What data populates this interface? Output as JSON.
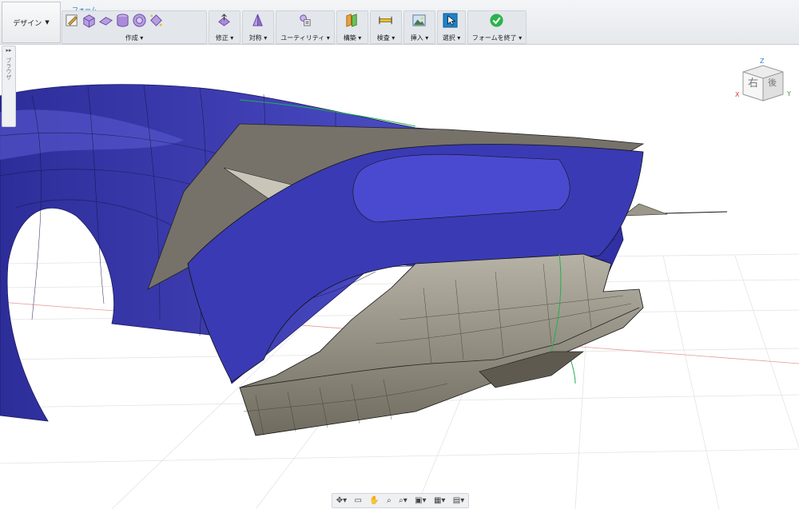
{
  "workspace": {
    "label": "デザイン"
  },
  "ribbon": {
    "active_tab": "フォーム",
    "groups": [
      {
        "id": "create",
        "label": "作成"
      },
      {
        "id": "modify",
        "label": "修正"
      },
      {
        "id": "symmetry",
        "label": "対称"
      },
      {
        "id": "utility",
        "label": "ユーティリティ"
      },
      {
        "id": "construct",
        "label": "構築"
      },
      {
        "id": "inspect",
        "label": "検査"
      },
      {
        "id": "insert",
        "label": "挿入"
      },
      {
        "id": "select",
        "label": "選択"
      },
      {
        "id": "finish",
        "label": "フォームを終了"
      }
    ]
  },
  "browser": {
    "label": "ブラウザ"
  },
  "viewcube": {
    "face_right": "右",
    "face_back": "後",
    "axis_x": "X",
    "axis_y": "Y",
    "axis_z": "Z"
  },
  "colors": {
    "body_blue": "#3434a8",
    "surface_gray": "#8a8576",
    "accent_green": "#22b14c",
    "ribbon_accent": "#1a6fc0"
  }
}
